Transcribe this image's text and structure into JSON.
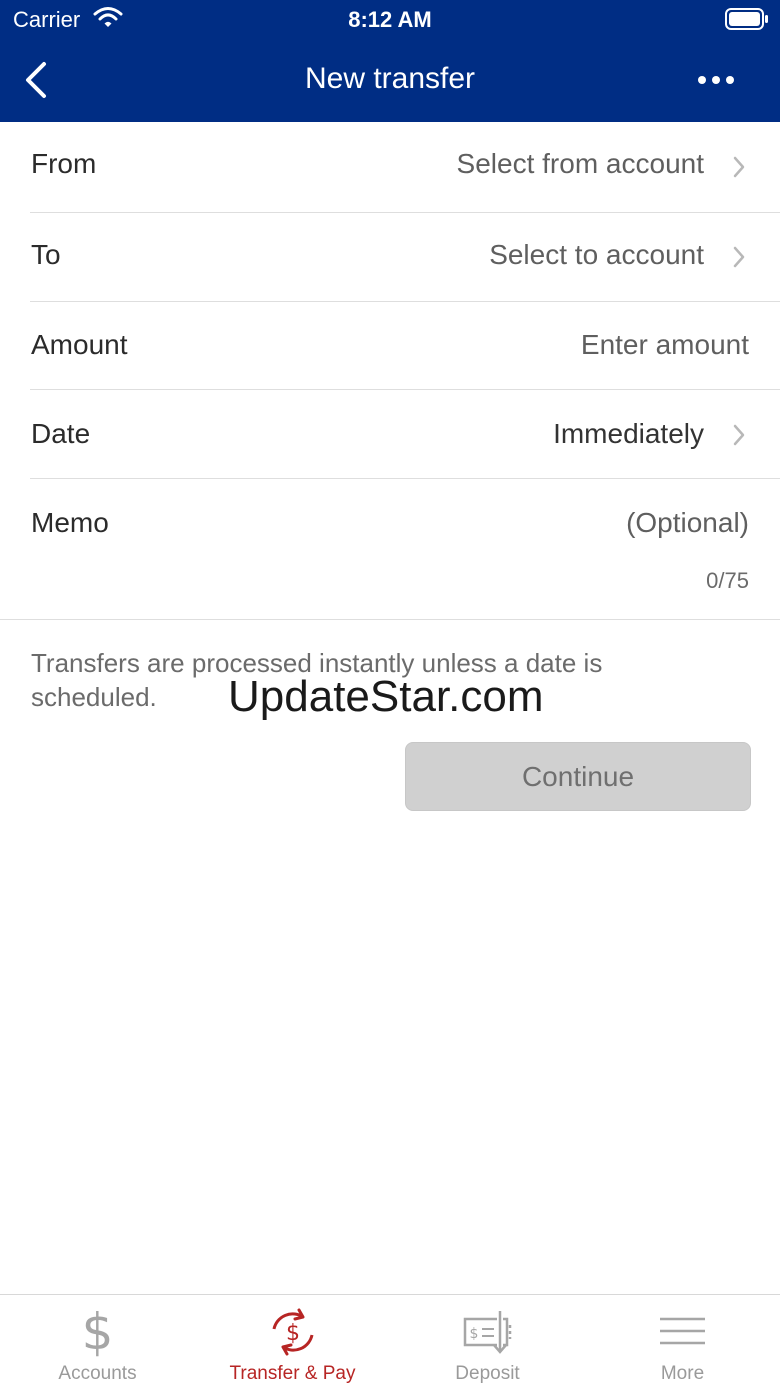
{
  "status_bar": {
    "carrier": "Carrier",
    "time": "8:12 AM"
  },
  "header": {
    "title": "New transfer"
  },
  "form": {
    "from": {
      "label": "From",
      "value": "Select from account"
    },
    "to": {
      "label": "To",
      "value": "Select to account"
    },
    "amount": {
      "label": "Amount",
      "placeholder": "Enter amount"
    },
    "date": {
      "label": "Date",
      "value": "Immediately"
    },
    "memo": {
      "label": "Memo",
      "placeholder": "(Optional)",
      "counter": "0/75"
    }
  },
  "info_text": "Transfers are processed instantly unless a date is scheduled.",
  "watermark": "UpdateStar.com",
  "continue_label": "Continue",
  "tabs": [
    {
      "label": "Accounts",
      "icon": "dollar-icon",
      "active": false
    },
    {
      "label": "Transfer & Pay",
      "icon": "transfer-pay-icon",
      "active": true
    },
    {
      "label": "Deposit",
      "icon": "check-deposit-icon",
      "active": false
    },
    {
      "label": "More",
      "icon": "menu-icon",
      "active": false
    }
  ],
  "colors": {
    "header": "#002d84",
    "active_tab": "#b72524",
    "inactive_tab": "#9a9a9a",
    "button_disabled": "#d0d0d0"
  }
}
